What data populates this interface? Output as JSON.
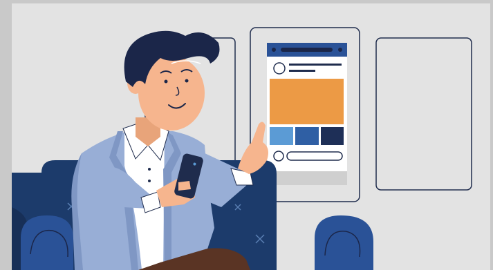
{
  "colors": {
    "outer_frame": "#c9c9c9",
    "wall": "#e3e3e3",
    "outline": "#1f2c4d",
    "sofa": "#1c3b6b",
    "sofa_dark": "#172f57",
    "sofa_seam": "#5a7fb3",
    "jacket": "#98aed6",
    "jacket_shadow": "#7f97c4",
    "skin": "#f6b58e",
    "hair": "#1b2649",
    "shirt": "#ffffff",
    "phone": "#1f2c4d",
    "pants": "#5a3424",
    "app_header": "#2a5297",
    "app_banner": "#ec9a45",
    "app_tile_1": "#5b9bd5",
    "app_tile_2": "#2f5fa4",
    "app_tile_3": "#1e2f57",
    "app_footer": "#cfcfcf"
  },
  "icons": {
    "phone": "smartphone-icon",
    "feed": "social-feed-icon",
    "avatar": "profile-avatar-icon"
  }
}
